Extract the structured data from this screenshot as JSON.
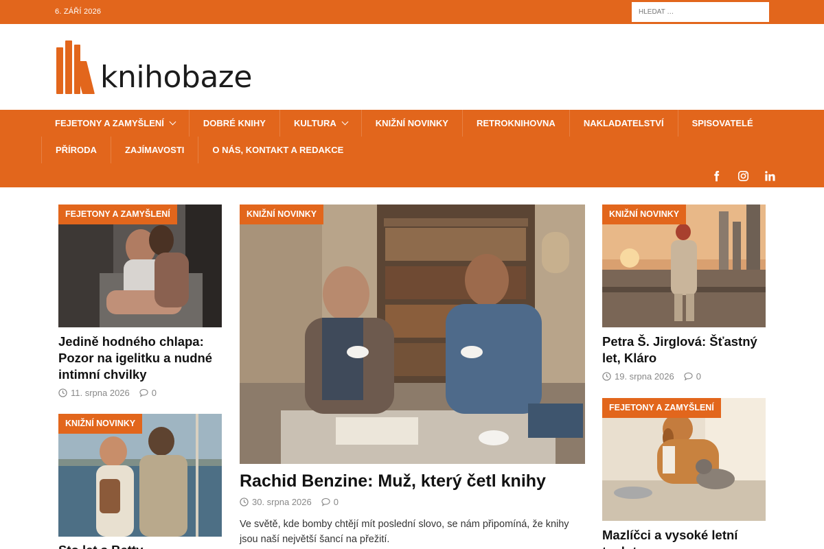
{
  "topbar": {
    "date": "6. ZÁŘÍ 2026",
    "search_placeholder": "HLEDAT …"
  },
  "logo": {
    "text": "knihobaze"
  },
  "nav": {
    "row1": [
      {
        "label": "FEJETONY A ZAMYŠLENÍ",
        "has_dropdown": true
      },
      {
        "label": "DOBRÉ KNIHY",
        "has_dropdown": false
      },
      {
        "label": "KULTURA",
        "has_dropdown": true
      },
      {
        "label": "KNIŽNÍ NOVINKY",
        "has_dropdown": false
      },
      {
        "label": "RETROKNIHOVNA",
        "has_dropdown": false
      },
      {
        "label": "NAKLADATELSTVÍ",
        "has_dropdown": false
      },
      {
        "label": "SPISOVATELÉ",
        "has_dropdown": false
      }
    ],
    "row2": [
      {
        "label": "PŘÍRODA"
      },
      {
        "label": "ZAJÍMAVOSTI"
      },
      {
        "label": "O NÁS, KONTAKT A REDAKCE"
      }
    ],
    "social": [
      "facebook-icon",
      "instagram-icon",
      "linkedin-icon"
    ]
  },
  "articles": {
    "left1": {
      "category": "FEJETONY A ZAMYŠLENÍ",
      "title": "Jedině hodného chlapa: Pozor na igelitku a nudné intimní chvilky",
      "date": "11. srpna 2026",
      "comments": "0"
    },
    "left2": {
      "category": "KNIŽNÍ NOVINKY",
      "title": "Sto let s Betty"
    },
    "center": {
      "category": "KNIŽNÍ NOVINKY",
      "title": "Rachid Benzine: Muž, který četl knihy",
      "date": "30. srpna 2026",
      "comments": "0",
      "excerpt": "Ve světě, kde bomby chtějí mít poslední slovo, se nám připomíná, že knihy jsou naší největší šancí na přežití."
    },
    "right1": {
      "category": "KNIŽNÍ NOVINKY",
      "title": "Petra Š. Jirglová: Šťastný let, Kláro",
      "date": "19. srpna 2026",
      "comments": "0"
    },
    "right2": {
      "category": "FEJETONY A ZAMYŠLENÍ",
      "title": "Mazlíčci a vysoké letní teploty"
    }
  },
  "colors": {
    "accent": "#e2661c",
    "text": "#111111",
    "meta": "#888888"
  }
}
